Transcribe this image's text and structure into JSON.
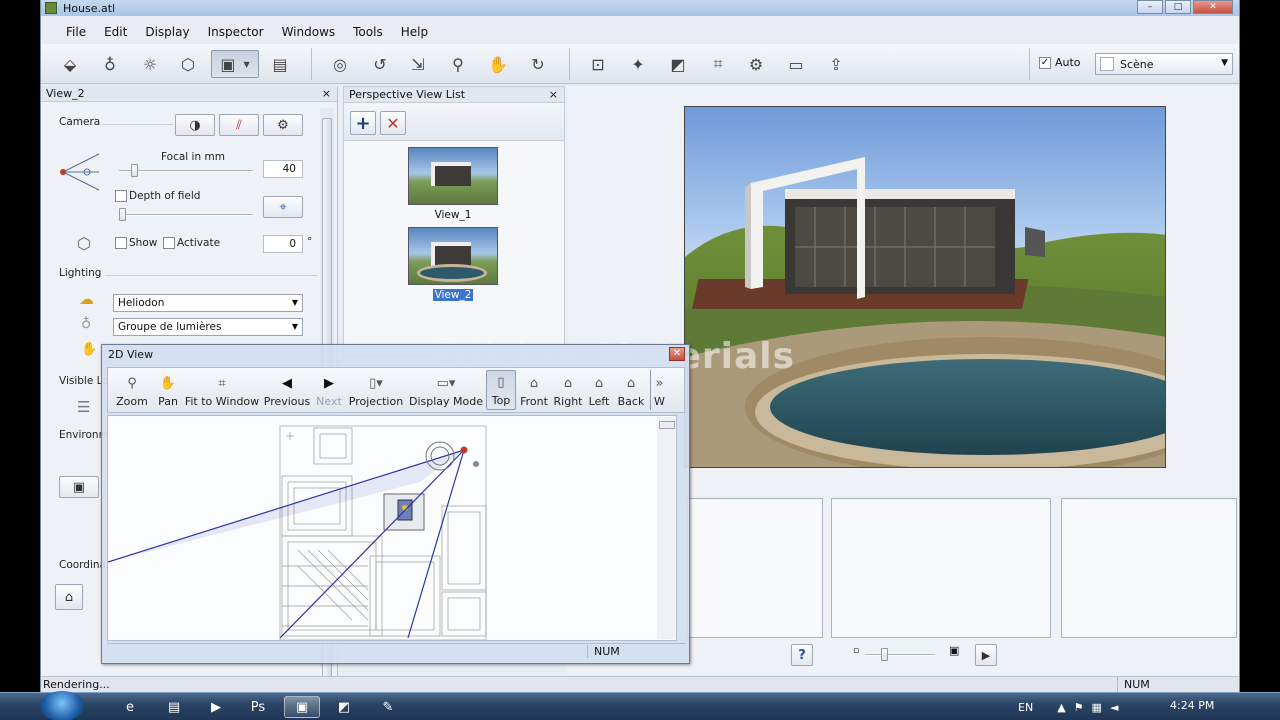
{
  "window": {
    "title": "House.atl",
    "controls": [
      "–",
      "□",
      "✕"
    ]
  },
  "menu": [
    "File",
    "Edit",
    "Display",
    "Inspector",
    "Windows",
    "Tools",
    "Help"
  ],
  "toolbar": {
    "auto_label": "Auto",
    "auto_checked": true,
    "scene_label": "Scène"
  },
  "left_panel": {
    "header": "View_2",
    "camera_label": "Camera",
    "focal_label": "Focal in mm",
    "focal_value": "40",
    "depth_of_field_label": "Depth of field",
    "show_label": "Show",
    "activate_label": "Activate",
    "angle_value": "0",
    "angle_unit": "°",
    "lighting_label": "Lighting",
    "lighting_select": "Heliodon",
    "lights_group_select": "Groupe de lumières",
    "visible_layers_label": "Visible La",
    "environment_label": "Environm",
    "coordinates_label": "Coordina",
    "close": "×"
  },
  "perspective_list": {
    "header": "Perspective View List",
    "close": "×",
    "views": [
      {
        "label": "View_1",
        "selected": false
      },
      {
        "label": "View_2",
        "selected": true
      }
    ]
  },
  "view2d": {
    "title": "2D View",
    "close": "✕",
    "tools": [
      {
        "label": "Zoom",
        "icon": "zoom-icon"
      },
      {
        "label": "Pan",
        "icon": "pan-icon"
      },
      {
        "label": "Fit to Window",
        "icon": "fit-window-icon"
      },
      {
        "label": "Previous",
        "icon": "previous-icon"
      },
      {
        "label": "Next",
        "icon": "next-icon"
      },
      {
        "label": "Projection",
        "icon": "projection-icon"
      },
      {
        "label": "Display Mode",
        "icon": "display-mode-icon"
      },
      {
        "label": "Top",
        "icon": "top-view-icon"
      },
      {
        "label": "Front",
        "icon": "front-view-icon"
      },
      {
        "label": "Right",
        "icon": "right-view-icon"
      },
      {
        "label": "Left",
        "icon": "left-view-icon"
      },
      {
        "label": "Back",
        "icon": "back-view-icon"
      },
      {
        "label": "W",
        "icon": "more-icon"
      }
    ],
    "status_num": "NUM"
  },
  "watermark": "Editing Materials",
  "status": {
    "text": "Rendering...",
    "num": "NUM"
  },
  "taskbar": {
    "language": "EN",
    "time": "4:24 PM"
  },
  "colors": {
    "selection": "#3a73d0",
    "camera_line": "#2a35a8",
    "accent_red": "#c0392b"
  }
}
